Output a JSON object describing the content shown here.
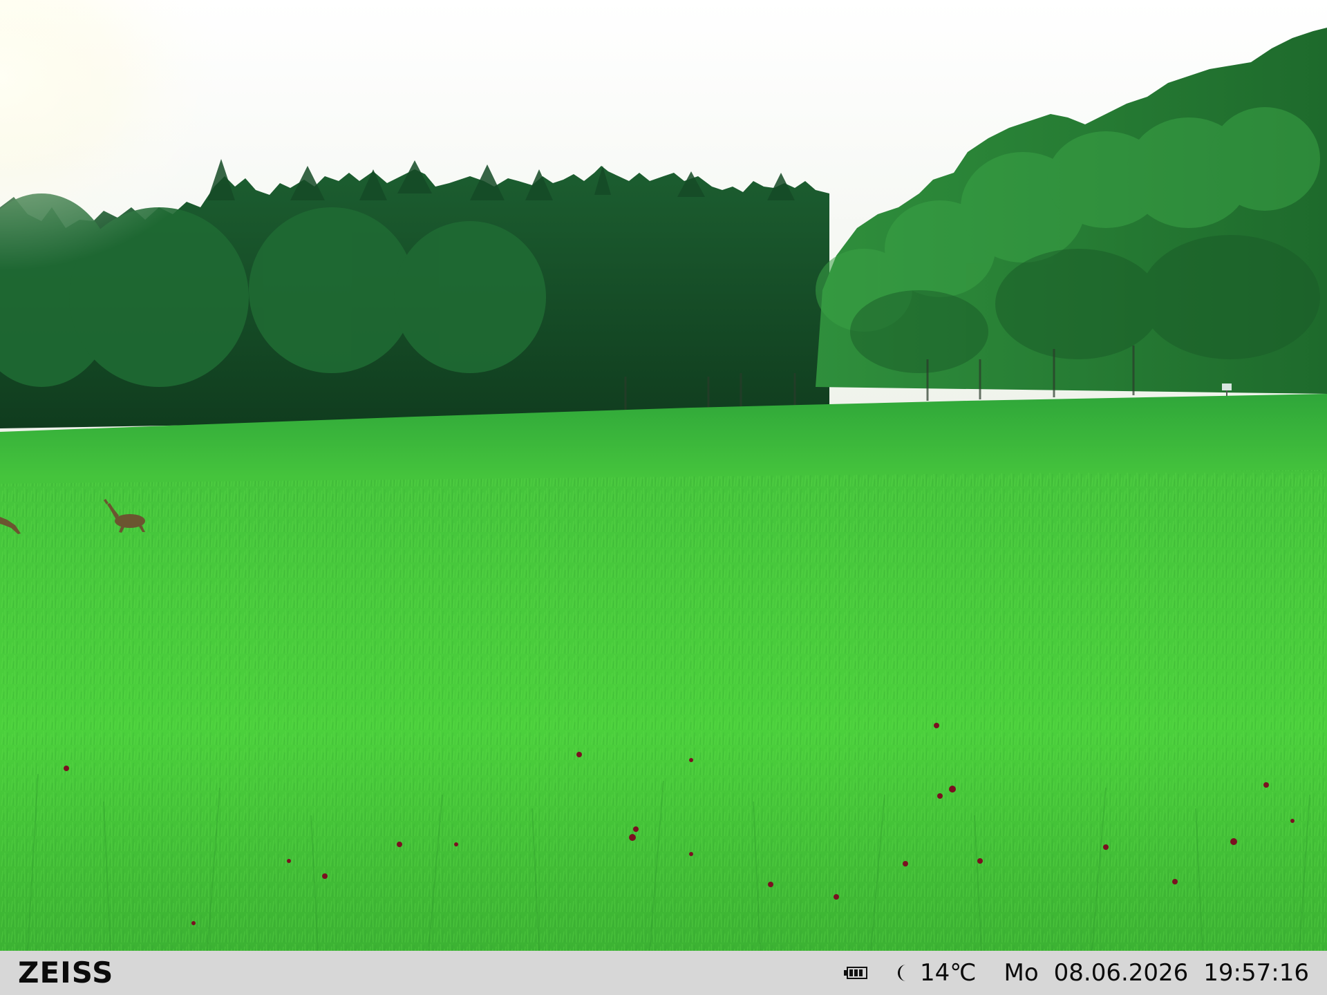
{
  "scene": {
    "description_icon": "landscape-photo",
    "colors": {
      "sky": "#f7f8f2",
      "forest_dark": "#17502a",
      "forest_mid": "#1f6a33",
      "forest_light": "#2f9040",
      "meadow_far": "#3fb43a",
      "meadow_near": "#4ad23a",
      "clover": "#7a1020",
      "deer": "#6b5530"
    }
  },
  "info_bar": {
    "brand": "ZEISS",
    "battery_icon": "battery-icon",
    "moon_icon": "moon-icon",
    "temperature": "14℃",
    "weekday": "Mo",
    "date": "08.06.2026",
    "time": "19:57:16",
    "colors": {
      "background": "#d7d7d7",
      "text": "#0b0b0b"
    }
  }
}
